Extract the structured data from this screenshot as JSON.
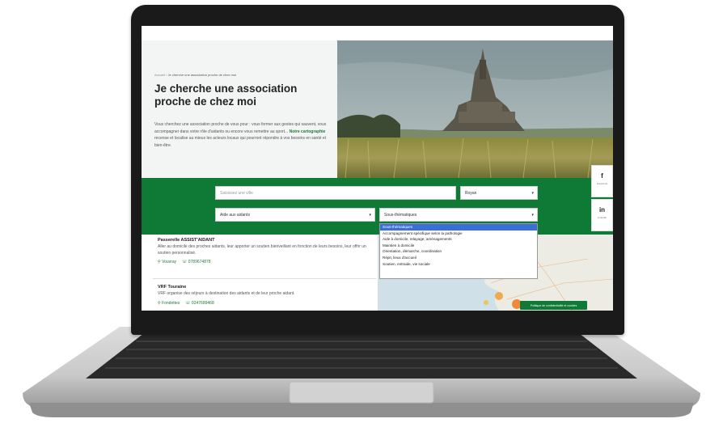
{
  "page": {
    "breadcrumb_home": "Accueil",
    "breadcrumb_current": "Je cherche une association proche de chez moi",
    "title": "Je cherche une association proche de chez moi",
    "intro_before": "Vous cherchez une association proche de vous pour : vous former aux gestes qui sauvent, vous accompagner dans votre rôle d'aidants ou encore vous remettre au sport... ",
    "intro_link": "Notre cartographie",
    "intro_after": " recense et localise au mieux les acteurs locaux qui pourront répondre à vos besoins en santé et bien-être."
  },
  "search": {
    "city_placeholder": "Saisissez une ville",
    "city_select_value": "Royan",
    "category_value": "Aide aux aidants",
    "subtheme_value": "Sous-thématiques"
  },
  "dropdown": {
    "options": [
      "Sous-thématiques",
      "Accompagnement spécifique selon la pathologie",
      "Aide à domicile, relayage, aménagements",
      "Maintien à domicile",
      "Orientation, démarche, coordination",
      "Répit, lieux d'accueil",
      "Soutien, entraide, vie sociale"
    ],
    "selected_index": 0
  },
  "results": [
    {
      "name": "Passerelle ASSIST'AIDANT",
      "description": "Aller au domicile des proches aidants, leur apporter un soutien bienveillant en fonction de leurs besoins, leur offrir un soutien personnalisé.",
      "city": "Vouvray",
      "phone": "0789674878"
    },
    {
      "name": "VRF Touraine",
      "description": "VRF organise des séjours à destination des aidants et de leur proche aidant.",
      "city": "Fondettes",
      "phone": "0247689468"
    }
  ],
  "social": {
    "facebook_glyph": "f",
    "facebook_label": "Facebook",
    "linkedin_glyph": "in",
    "linkedin_label": "LinkedIn"
  },
  "cookie_label": "Politique de confidentialité et cookies",
  "icons": {
    "location": "location-pin-icon",
    "phone": "phone-icon"
  },
  "colors": {
    "brand_green": "#0f7a35",
    "select_highlight": "#3a6fd8"
  }
}
